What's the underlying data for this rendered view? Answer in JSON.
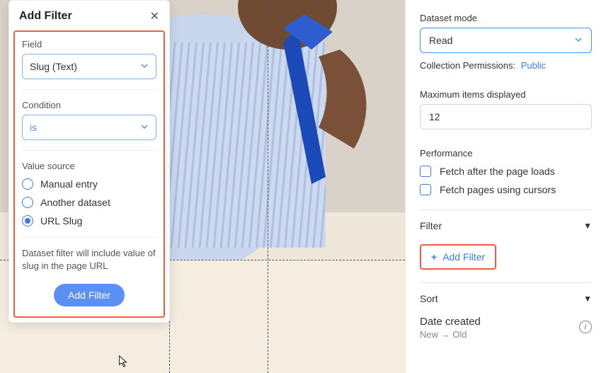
{
  "popover": {
    "title": "Add Filter",
    "field_label": "Field",
    "field_value": "Slug (Text)",
    "condition_label": "Condition",
    "condition_value": "is",
    "value_source_label": "Value source",
    "radios": [
      {
        "label": "Manual entry"
      },
      {
        "label": "Another dataset"
      },
      {
        "label": "URL Slug"
      }
    ],
    "selected_radio_index": 2,
    "note": "Dataset filter will include value of slug in the page URL",
    "submit_label": "Add Filter"
  },
  "panel": {
    "dataset_mode_label": "Dataset mode",
    "dataset_mode_value": "Read",
    "permissions_label": "Collection Permissions:",
    "permissions_value": "Public",
    "max_items_label": "Maximum items displayed",
    "max_items_value": "12",
    "performance_label": "Performance",
    "checks": [
      {
        "label": "Fetch after the page loads"
      },
      {
        "label": "Fetch pages using cursors"
      }
    ],
    "filter_section": "Filter",
    "add_filter_label": "Add Filter",
    "sort_section": "Sort",
    "sort_title": "Date created",
    "sort_dir": "New → Old"
  },
  "colors": {
    "highlight": "#f25c3b",
    "accent": "#3b7ced"
  }
}
